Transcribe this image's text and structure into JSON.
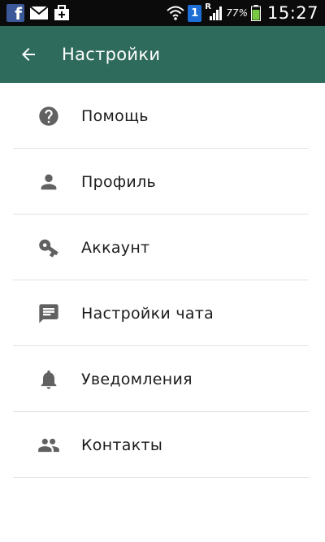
{
  "status_bar": {
    "battery": "77%",
    "time": "15:27",
    "sim": "1",
    "roaming": "R"
  },
  "app_bar": {
    "title": "Настройки"
  },
  "settings": {
    "items": [
      {
        "label": "Помощь",
        "icon": "help-circle-icon"
      },
      {
        "label": "Профиль",
        "icon": "person-icon"
      },
      {
        "label": "Аккаунт",
        "icon": "key-icon"
      },
      {
        "label": "Настройки чата",
        "icon": "chat-icon"
      },
      {
        "label": "Уведомления",
        "icon": "bell-icon"
      },
      {
        "label": "Контакты",
        "icon": "contacts-icon"
      }
    ]
  },
  "colors": {
    "app_bar": "#2f6b5c",
    "status_bar": "#0b0b0b",
    "icon": "#616161"
  }
}
